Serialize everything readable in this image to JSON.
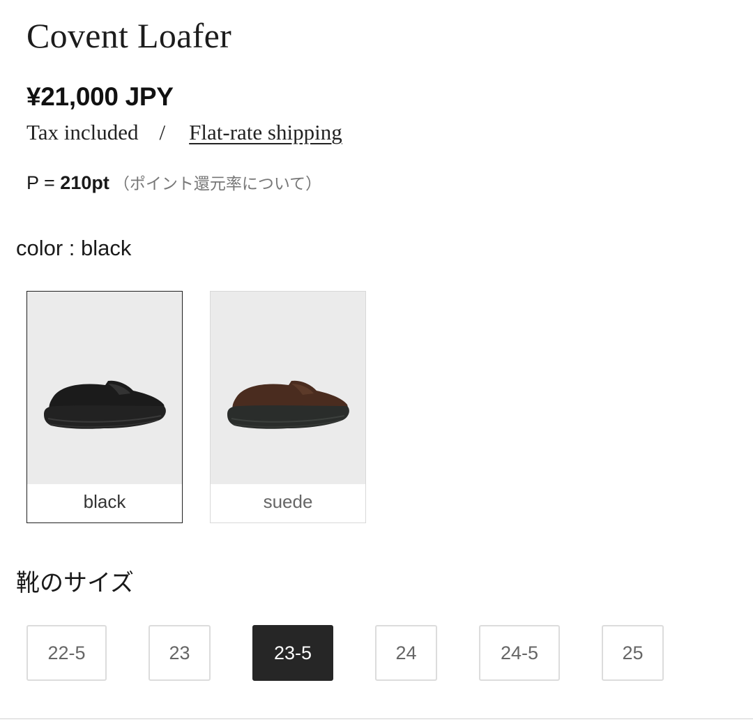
{
  "product": {
    "title": "Covent Loafer",
    "price": "¥21,000 JPY",
    "tax_text": "Tax included",
    "separator": "/",
    "shipping_link": "Flat-rate shipping",
    "points_prefix": "P = ",
    "points_value": "210pt",
    "points_note": "（ポイント還元率について）"
  },
  "color": {
    "label": "color : black",
    "options": [
      {
        "name": "black",
        "selected": true,
        "shoe_color": "#1b1b1b"
      },
      {
        "name": "suede",
        "selected": false,
        "shoe_color": "#4a2c1f"
      }
    ]
  },
  "size": {
    "label": "靴のサイズ",
    "options": [
      {
        "label": "22-5",
        "selected": false
      },
      {
        "label": "23",
        "selected": false
      },
      {
        "label": "23-5",
        "selected": true
      },
      {
        "label": "24",
        "selected": false
      },
      {
        "label": "24-5",
        "selected": false
      },
      {
        "label": "25",
        "selected": false
      }
    ]
  },
  "colors": {
    "selected_bg": "#262626",
    "border": "#dcdcdc",
    "swatch_bg": "#ebebeb"
  }
}
